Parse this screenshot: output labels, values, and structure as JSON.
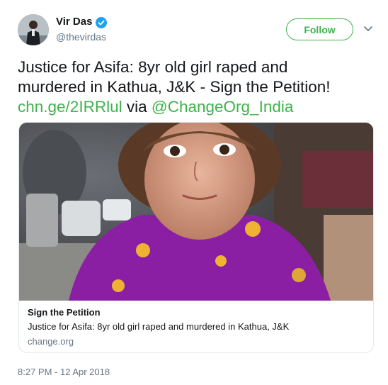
{
  "user": {
    "display_name": "Vir Das",
    "handle": "@thevirdas",
    "verified": true
  },
  "follow_button": {
    "label": "Follow"
  },
  "tweet": {
    "text_line1": "Justice for Asifa: 8yr old girl raped and",
    "text_line2": "murdered in Kathua, J&K - Sign the Petition!",
    "link": "chn.ge/2IRRlul",
    "via": "via",
    "mention": "@ChangeOrg_India"
  },
  "card": {
    "title": "Sign the Petition",
    "description": "Justice for Asifa: 8yr old girl raped and murdered in Kathua, J&K",
    "domain": "change.org"
  },
  "timestamp": "8:27 PM - 12 Apr 2018",
  "colors": {
    "accent": "#3fb24b",
    "verified_badge": "#1da1f2",
    "secondary_text": "#657786"
  },
  "icons": {
    "verified": "verified-badge-icon",
    "menu": "chevron-down-icon"
  }
}
